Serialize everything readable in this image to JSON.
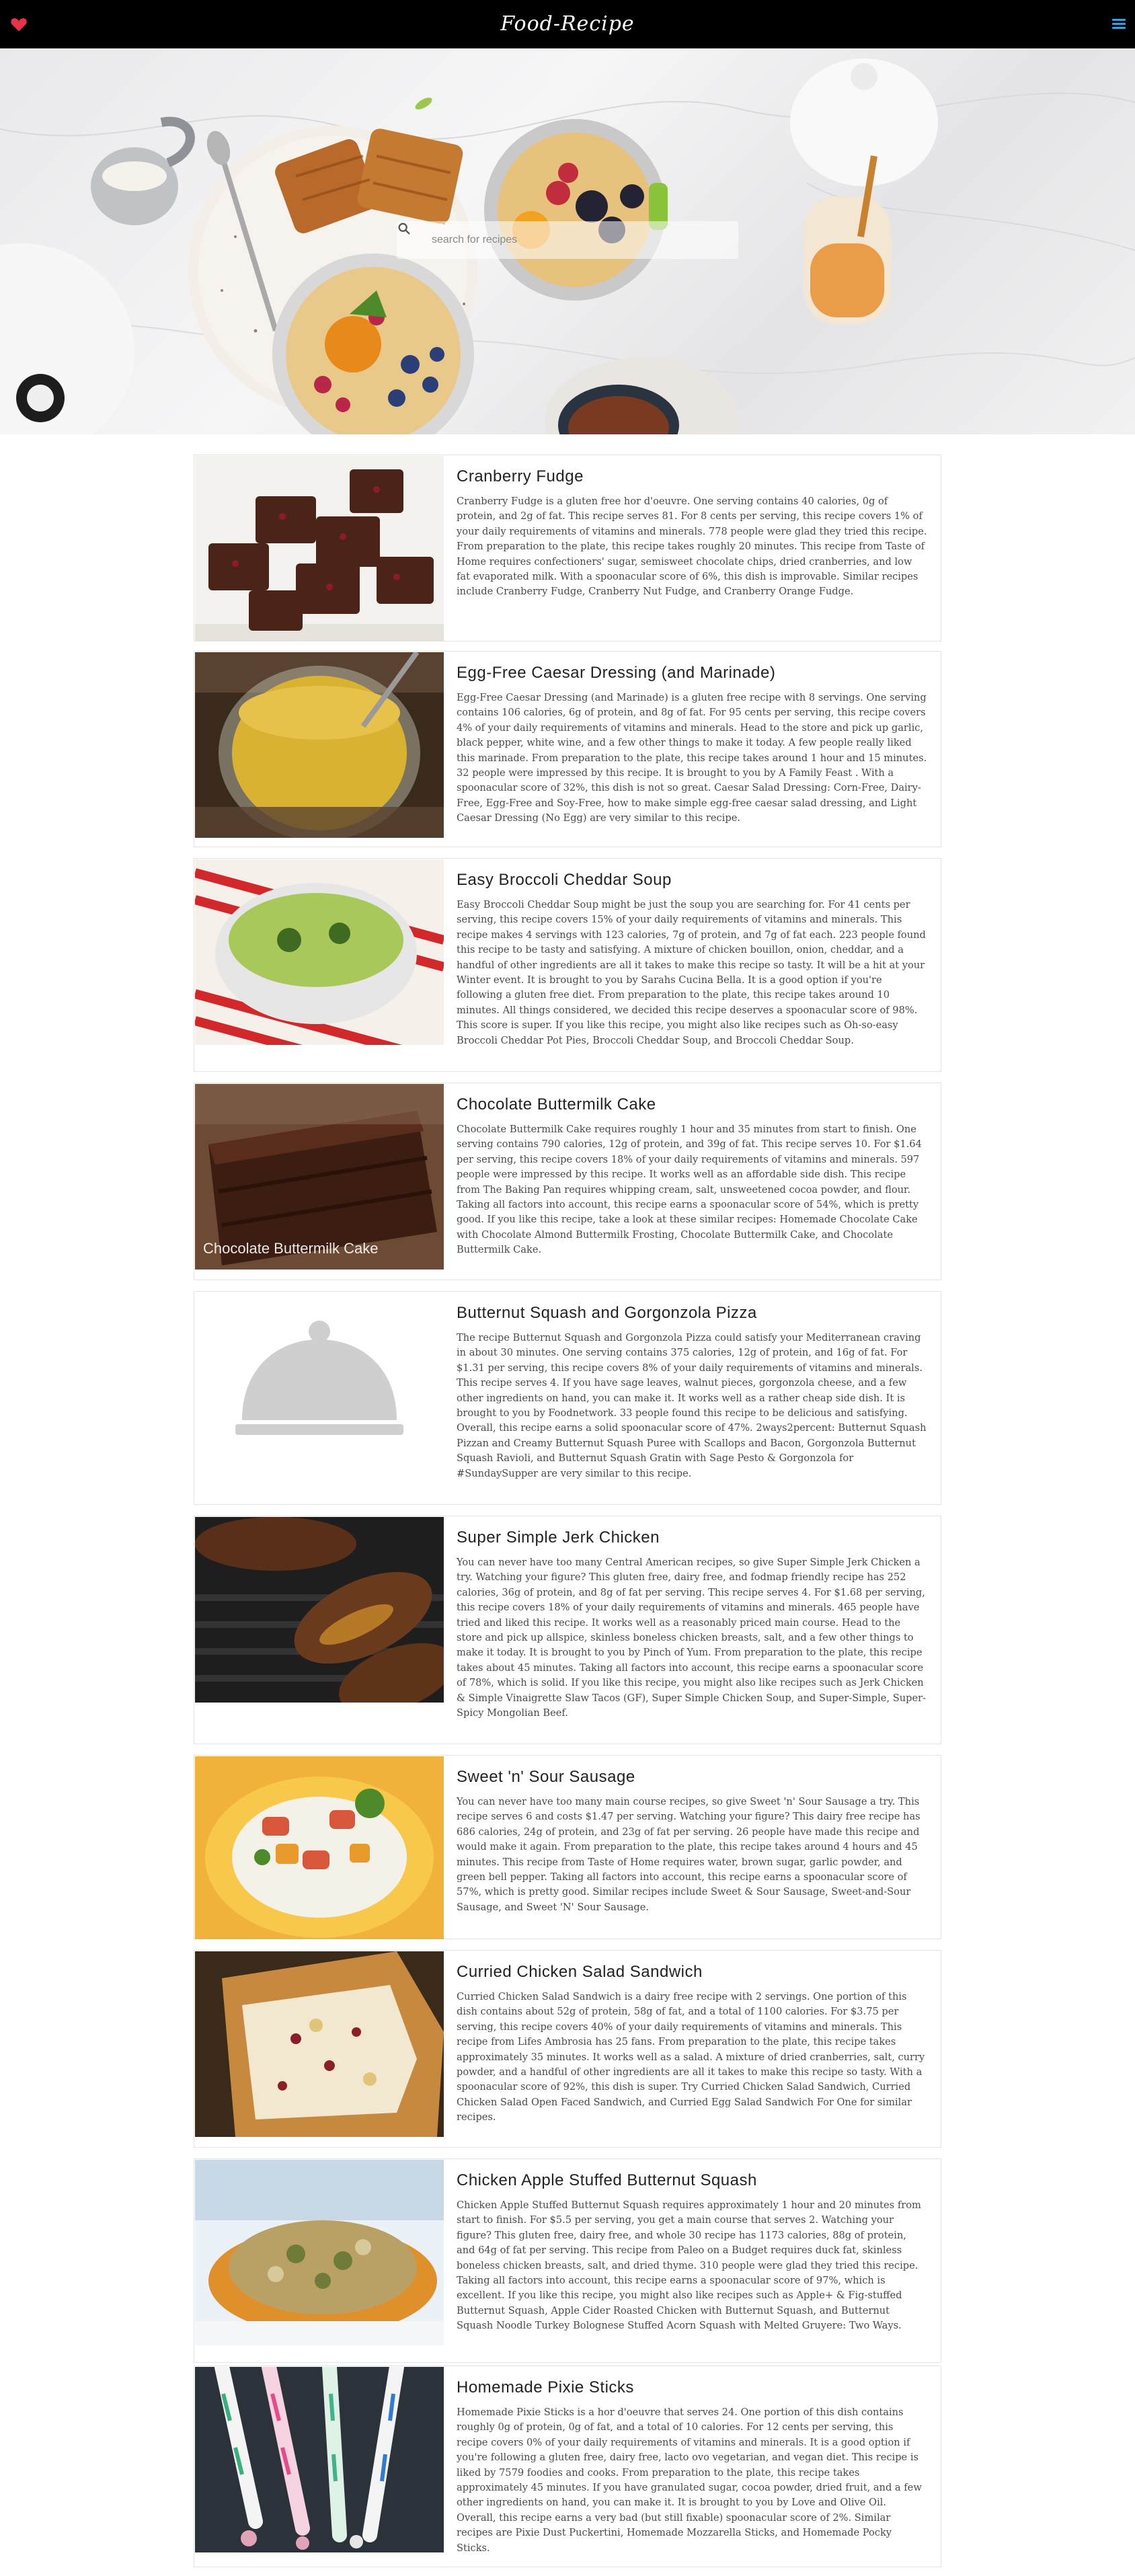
{
  "header": {
    "title": "Food-Recipe",
    "logo_icon": "heart-icon",
    "menu_icon": "hamburger-menu-icon",
    "accent": "#e8334a"
  },
  "search": {
    "placeholder": "search for recipes"
  },
  "recipes": [
    {
      "title": "Cranberry Fudge",
      "image": "fudge-photo",
      "summary": "Cranberry Fudge is a gluten free hor d'oeuvre. One serving contains 40 calories, 0g of protein, and 2g of fat. This recipe serves 81. For 8 cents per serving, this recipe covers 1% of your daily requirements of vitamins and minerals. 778 people were glad they tried this recipe. From preparation to the plate, this recipe takes roughly 20 minutes. This recipe from Taste of Home requires confectioners' sugar, semisweet chocolate chips, dried cranberries, and low fat evaporated milk. With a spoonacular score of 6%, this dish is improvable. Similar recipes include Cranberry Fudge, Cranberry Nut Fudge, and Cranberry Orange Fudge."
    },
    {
      "title": "Egg-Free Caesar Dressing (and Marinade)",
      "image": "dressing-photo",
      "summary": "Egg-Free Caesar Dressing (and Marinade) is a gluten free recipe with 8 servings. One serving contains 106 calories, 6g of protein, and 8g of fat. For 95 cents per serving, this recipe covers 4% of your daily requirements of vitamins and minerals. Head to the store and pick up garlic, black pepper, white wine, and a few other things to make it today. A few people really liked this marinade. From preparation to the plate, this recipe takes around 1 hour and 15 minutes. 32 people were impressed by this recipe. It is brought to you by A Family Feast . With a spoonacular score of 32%, this dish is not so great. Caesar Salad Dressing: Corn-Free, Dairy-Free, Egg-Free and Soy-Free, how to make simple egg-free caesar salad dressing, and Light Caesar Dressing (No Egg) are very similar to this recipe."
    },
    {
      "title": "Easy Broccoli Cheddar Soup",
      "image": "soup-photo",
      "summary": "Easy Broccoli Cheddar Soup might be just the soup you are searching for. For 41 cents per serving, this recipe covers 15% of your daily requirements of vitamins and minerals. This recipe makes 4 servings with 123 calories, 7g of protein, and 7g of fat each. 223 people found this recipe to be tasty and satisfying. A mixture of chicken bouillon, onion, cheddar, and a handful of other ingredients are all it takes to make this recipe so tasty. It will be a hit at your Winter event. It is brought to you by Sarahs Cucina Bella. It is a good option if you're following a gluten free diet. From preparation to the plate, this recipe takes around 10 minutes. All things considered, we decided this recipe deserves a spoonacular score of 98%. This score is super. If you like this recipe, you might also like recipes such as Oh-so-easy Broccoli Cheddar Pot Pies, Broccoli Cheddar Soup, and Broccoli Cheddar Soup."
    },
    {
      "title": "Chocolate Buttermilk Cake",
      "image": "cake-photo",
      "image_caption": "Chocolate Buttermilk Cake",
      "summary": "Chocolate Buttermilk Cake requires roughly 1 hour and 35 minutes from start to finish. One serving contains 790 calories, 12g of protein, and 39g of fat. This recipe serves 10. For $1.64 per serving, this recipe covers 18% of your daily requirements of vitamins and minerals. 597 people were impressed by this recipe. It works well as an affordable side dish. This recipe from The Baking Pan requires whipping cream, salt, unsweetened cocoa powder, and flour. Taking all factors into account, this recipe earns a spoonacular score of 54%, which is pretty good. If you like this recipe, take a look at these similar recipes: Homemade Chocolate Cake with Chocolate Almond Buttermilk Frosting, Chocolate Buttermilk Cake, and Chocolate Buttermilk Cake."
    },
    {
      "title": "Butternut Squash and Gorgonzola Pizza",
      "image": "cloche-placeholder-icon",
      "summary": "The recipe Butternut Squash and Gorgonzola Pizza could satisfy your Mediterranean craving in about 30 minutes. One serving contains 375 calories, 12g of protein, and 16g of fat. For $1.31 per serving, this recipe covers 8% of your daily requirements of vitamins and minerals. This recipe serves 4. If you have sage leaves, walnut pieces, gorgonzola cheese, and a few other ingredients on hand, you can make it. It works well as a rather cheap side dish. It is brought to you by Foodnetwork. 33 people found this recipe to be delicious and satisfying. Overall, this recipe earns a solid spoonacular score of 47%. 2ways2percent: Butternut Squash Pizzan and Creamy Butternut Squash Puree with Scallops and Bacon, Gorgonzola Butternut Squash Ravioli, and Butternut Squash Gratin with Sage Pesto & Gorgonzola for #SundaySupper are very similar to this recipe."
    },
    {
      "title": "Super Simple Jerk Chicken",
      "image": "jerk-chicken-photo",
      "summary": "You can never have too many Central American recipes, so give Super Simple Jerk Chicken a try. Watching your figure? This gluten free, dairy free, and fodmap friendly recipe has 252 calories, 36g of protein, and 8g of fat per serving. This recipe serves 4. For $1.68 per serving, this recipe covers 18% of your daily requirements of vitamins and minerals. 465 people have tried and liked this recipe. It works well as a reasonably priced main course. Head to the store and pick up allspice, skinless boneless chicken breasts, salt, and a few other things to make it today. It is brought to you by Pinch of Yum. From preparation to the plate, this recipe takes about 45 minutes. Taking all factors into account, this recipe earns a spoonacular score of 78%, which is solid. If you like this recipe, you might also like recipes such as Jerk Chicken & Simple Vinaigrette Slaw Tacos (GF), Super Simple Chicken Soup, and Super-Simple, Super-Spicy Mongolian Beef."
    },
    {
      "title": "Sweet 'n' Sour Sausage",
      "image": "sausage-plate-photo",
      "summary": "You can never have too many main course recipes, so give Sweet 'n' Sour Sausage a try. This recipe serves 6 and costs $1.47 per serving. Watching your figure? This dairy free recipe has 686 calories, 24g of protein, and 23g of fat per serving. 26 people have made this recipe and would make it again. From preparation to the plate, this recipe takes around 4 hours and 45 minutes. This recipe from Taste of Home requires water, brown sugar, garlic powder, and green bell pepper. Taking all factors into account, this recipe earns a spoonacular score of 57%, which is pretty good. Similar recipes include Sweet & Sour Sausage, Sweet-and-Sour Sausage, and Sweet 'N' Sour Sausage."
    },
    {
      "title": "Curried Chicken Salad Sandwich",
      "image": "sandwich-photo",
      "summary": "Curried Chicken Salad Sandwich is a dairy free recipe with 2 servings. One portion of this dish contains about 52g of protein, 58g of fat, and a total of 1100 calories. For $3.75 per serving, this recipe covers 40% of your daily requirements of vitamins and minerals. This recipe from Lifes Ambrosia has 25 fans. From preparation to the plate, this recipe takes approximately 35 minutes. It works well as a salad. A mixture of dried cranberries, salt, curry powder, and a handful of other ingredients are all it takes to make this recipe so tasty. With a spoonacular score of 92%, this dish is super. Try Curried Chicken Salad Sandwich, Curried Chicken Salad Open Faced Sandwich, and Curried Egg Salad Sandwich For One for similar recipes."
    },
    {
      "title": "Chicken Apple Stuffed Butternut Squash",
      "image": "stuffed-squash-photo",
      "summary": "Chicken Apple Stuffed Butternut Squash requires approximately 1 hour and 20 minutes from start to finish. For $5.5 per serving, you get a main course that serves 2. Watching your figure? This gluten free, dairy free, and whole 30 recipe has 1173 calories, 88g of protein, and 64g of fat per serving. This recipe from Paleo on a Budget requires duck fat, skinless boneless chicken breasts, salt, and dried thyme. 310 people were glad they tried this recipe. Taking all factors into account, this recipe earns a spoonacular score of 97%, which is excellent. If you like this recipe, you might also like recipes such as Apple+ & Fig-stuffed Butternut Squash, Apple Cider Roasted Chicken with Butternut Squash, and Butternut Squash Noodle Turkey Bolognese Stuffed Acorn Squash with Melted Gruyere: Two Ways."
    },
    {
      "title": "Homemade Pixie Sticks",
      "image": "pixie-sticks-photo",
      "summary": "Homemade Pixie Sticks is a hor d'oeuvre that serves 24. One portion of this dish contains roughly 0g of protein, 0g of fat, and a total of 10 calories. For 12 cents per serving, this recipe covers 0% of your daily requirements of vitamins and minerals. It is a good option if you're following a gluten free, dairy free, lacto ovo vegetarian, and vegan diet. This recipe is liked by 7579 foodies and cooks. From preparation to the plate, this recipe takes approximately 45 minutes. If you have granulated sugar, cocoa powder, dried fruit, and a few other ingredients on hand, you can make it. It is brought to you by Love and Olive Oil. Overall, this recipe earns a very bad (but still fixable) spoonacular score of 2%. Similar recipes are Pixie Dust Puckertini, Homemade Mozzarella Sticks, and Homemade Pocky Sticks."
    }
  ]
}
